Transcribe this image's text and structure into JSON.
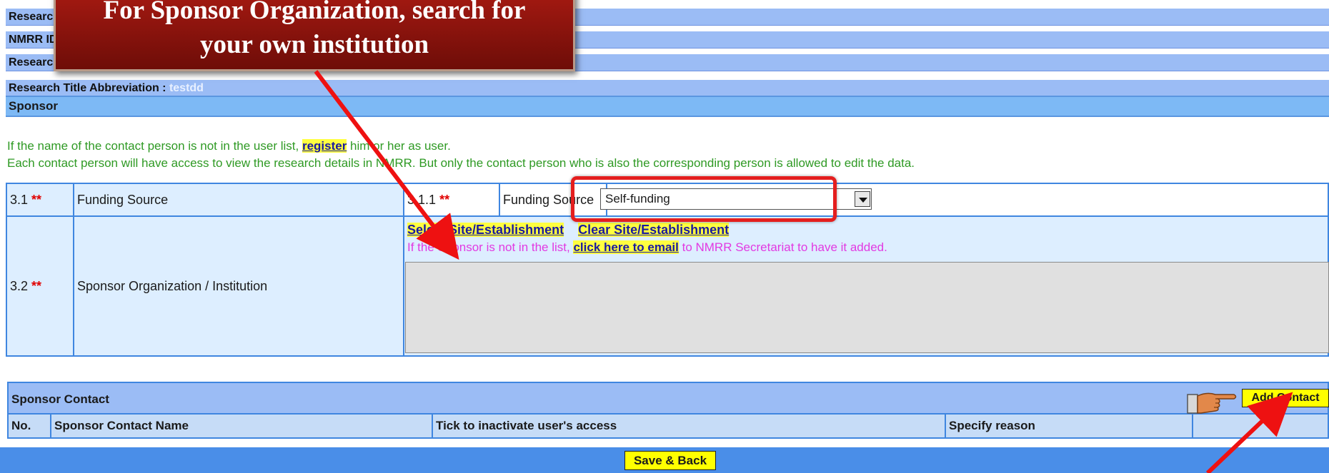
{
  "header_rows": [
    {
      "label": "Researc",
      "value": ""
    },
    {
      "label": "NMRR ID",
      "value": ""
    },
    {
      "label": "Researc",
      "value": ""
    },
    {
      "label": "Research Title Abbreviation : ",
      "value": "testdd"
    }
  ],
  "section_title": "Sponsor",
  "info": {
    "line1_before": "If the name of the contact person is not in the user list, ",
    "register_link": "register",
    "line1_after": " him or her as user.",
    "line2": "Each contact person will have access to view the research details in NMRR. But only the contact person who is also the corresponding person is allowed to edit the data."
  },
  "funding": {
    "num": "3.1",
    "req": "**",
    "label": "Funding Source",
    "sub_num": "3.1.1",
    "sub_req": "**",
    "sub_label": "Funding Source",
    "selected_value": "Self-funding"
  },
  "sponsor_org": {
    "num": "3.2",
    "req": "**",
    "label": "Sponsor Organization / Institution",
    "select_link": "Select Site/Establishment",
    "clear_link": "Clear Site/Establishment",
    "note_before": "If the Sponsor is not in the list, ",
    "email_link": "click here to email",
    "note_after": " to NMRR Secretariat to have it added."
  },
  "sponsor_contact": {
    "title": "Sponsor Contact",
    "add_button": "Add Contact",
    "columns": [
      "No.",
      "Sponsor Contact Name",
      "Tick to inactivate user's access",
      "Specify reason"
    ]
  },
  "footer": {
    "save_back": "Save & Back"
  },
  "callout": {
    "line1": "For Sponsor Organization, search for",
    "line2": "your own institution"
  },
  "colors": {
    "header_blue": "#9bbcf5",
    "accent_red": "#e41e1e",
    "button_yellow": "#ffff00"
  }
}
